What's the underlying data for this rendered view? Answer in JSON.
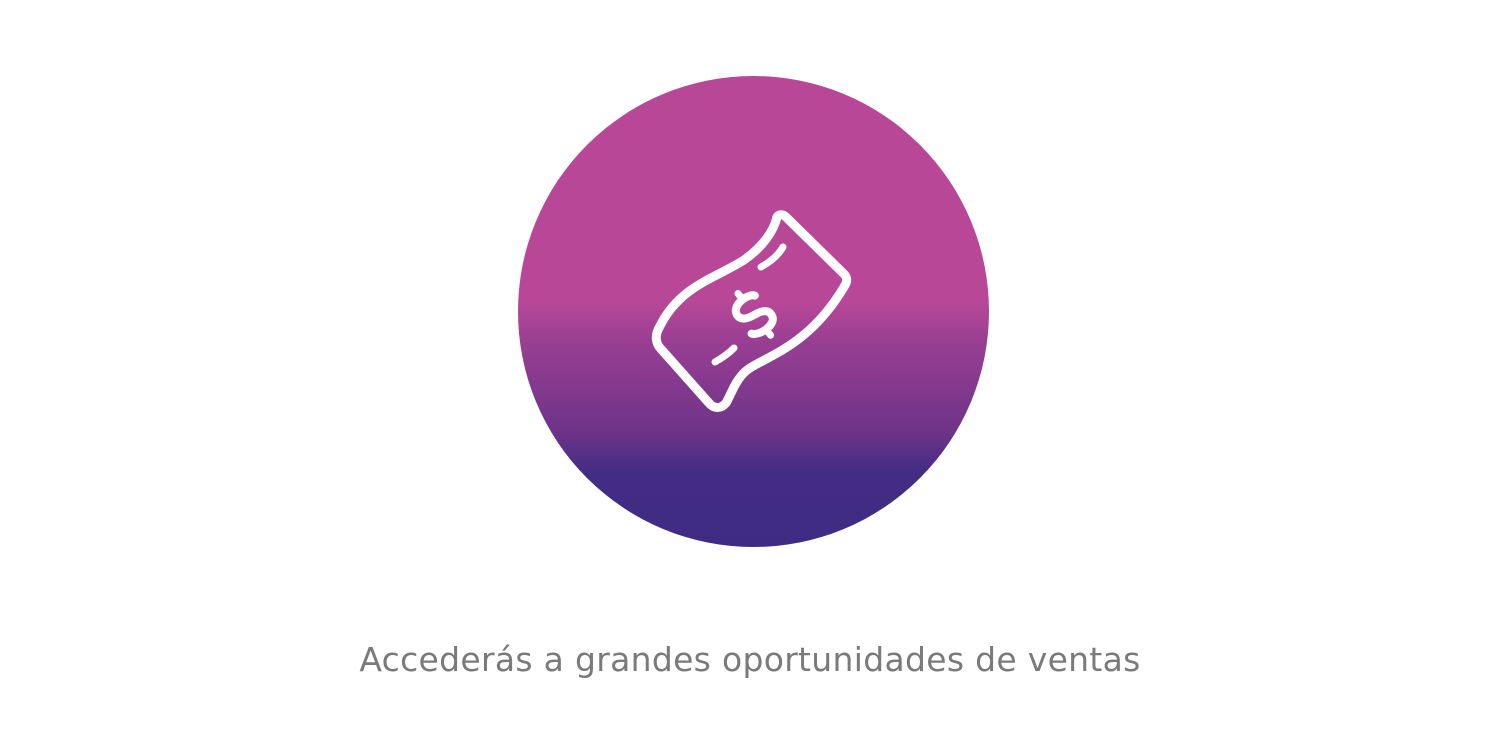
{
  "hero": {
    "icon": "money-bill-dollar-icon",
    "gradient": {
      "top": "#b84797",
      "bottom": "#3f2b82"
    },
    "icon_color": "#ffffff"
  },
  "caption": {
    "text": "Accederás a grandes oportunidades de ventas",
    "color": "#7a7a7a"
  }
}
